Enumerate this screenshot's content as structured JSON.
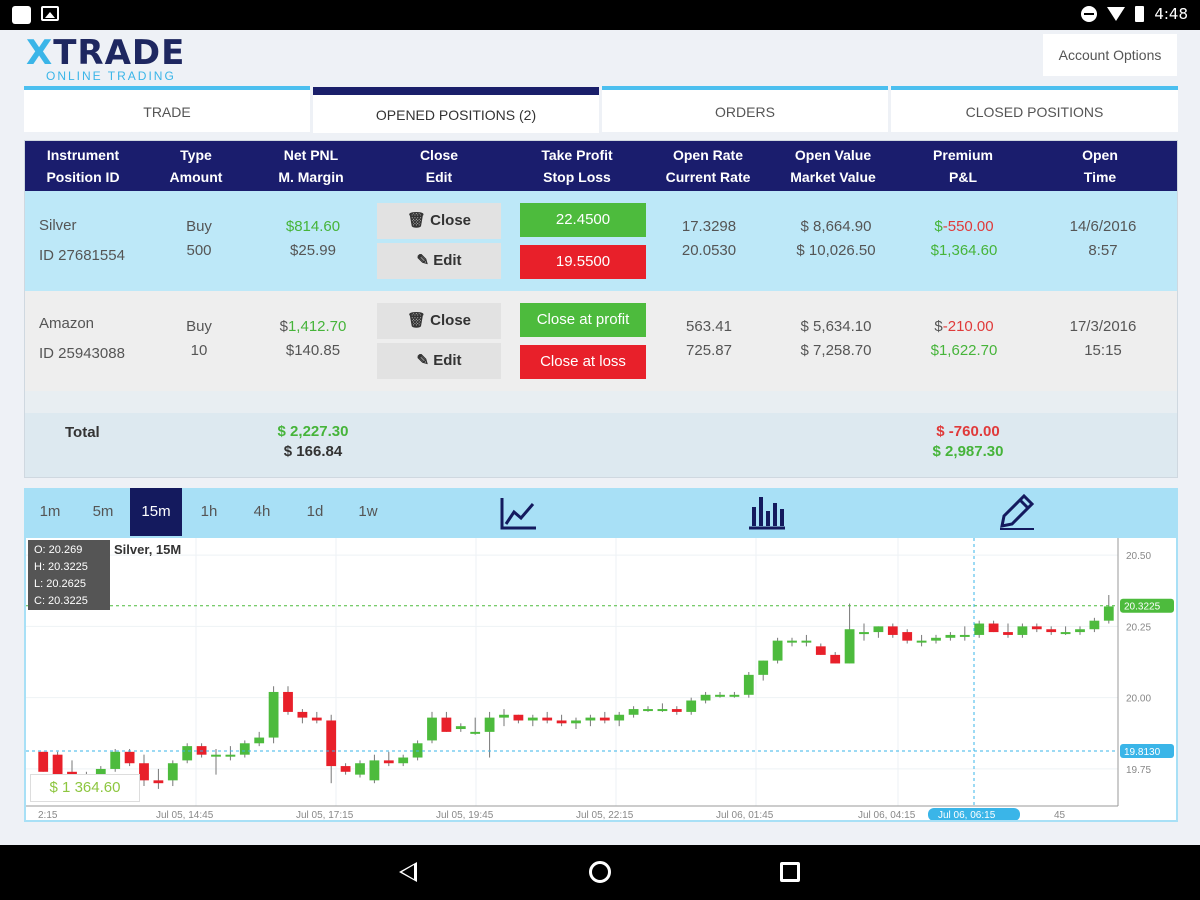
{
  "status_bar": {
    "time": "4:48"
  },
  "brand": {
    "logo_x": "X",
    "logo_rest": "TRADE",
    "tagline": "ONLINE TRADING"
  },
  "header": {
    "account_options": "Account Options"
  },
  "tabs": [
    {
      "label": "TRADE"
    },
    {
      "label": "OPENED POSITIONS (2)",
      "active": true
    },
    {
      "label": "ORDERS"
    },
    {
      "label": "CLOSED POSITIONS"
    }
  ],
  "table": {
    "columns": [
      {
        "line1": "Instrument",
        "line2": "Position ID"
      },
      {
        "line1": "Type",
        "line2": "Amount"
      },
      {
        "line1": "Net PNL",
        "line2": "M. Margin"
      },
      {
        "line1": "Close",
        "line2": "Edit"
      },
      {
        "line1": "Take Profit",
        "line2": "Stop Loss"
      },
      {
        "line1": "Open Rate",
        "line2": "Current Rate"
      },
      {
        "line1": "Open Value",
        "line2": "Market Value"
      },
      {
        "line1": "Premium",
        "line2": "P&L"
      },
      {
        "line1": "Open",
        "line2": "Time"
      }
    ],
    "rows": [
      {
        "instrument": "Silver",
        "position_id": "ID 27681554",
        "type": "Buy",
        "amount": "500",
        "pnl_symbol": "$",
        "pnl_value": "814.60",
        "margin": "$25.99",
        "close_label": "Close",
        "edit_label": "Edit",
        "take_profit": "22.4500",
        "stop_loss": "19.5500",
        "open_rate": "17.3298",
        "current_rate": "20.0530",
        "open_value": "$ 8,664.90",
        "market_value": "$ 10,026.50",
        "premium_symbol": "$",
        "premium_value": "-550.00",
        "pl": "$1,364.60",
        "open_date": "14/6/2016",
        "open_time": "8:57"
      },
      {
        "instrument": "Amazon",
        "position_id": "ID 25943088",
        "type": "Buy",
        "amount": "10",
        "pnl_symbol": "$",
        "pnl_value": "1,412.70",
        "margin": "$140.85",
        "close_label": "Close",
        "edit_label": "Edit",
        "take_profit": "Close at profit",
        "stop_loss": "Close at loss",
        "open_rate": "563.41",
        "current_rate": "725.87",
        "open_value": "$ 5,634.10",
        "market_value": "$ 7,258.70",
        "premium_symbol": "$",
        "premium_value": "-210.00",
        "pl": "$1,622.70",
        "open_date": "17/3/2016",
        "open_time": "15:15"
      }
    ],
    "total": {
      "label": "Total",
      "net_pnl": "$ 2,227.30",
      "margin": "$ 166.84",
      "premium": "$ -760.00",
      "pl": "$ 2,987.30"
    }
  },
  "chart_toolbar": {
    "timeframes": [
      "1m",
      "5m",
      "15m",
      "1h",
      "4h",
      "1d",
      "1w"
    ],
    "active": "15m",
    "tools": [
      "line-chart-icon",
      "bar-chart-icon",
      "draw-pen-icon"
    ]
  },
  "colors": {
    "accent": "#4bbfef",
    "brand": "#1a1d6d",
    "up": "#4dbb3d",
    "down": "#e8202a"
  },
  "chart_data": {
    "type": "candlestick",
    "title": "Silver, 15M",
    "ohlc_readout": {
      "o": "O: 20.269",
      "h": "H: 20.3225",
      "l": "L: 20.2625",
      "c": "C: 20.3225"
    },
    "ylim": [
      19.62,
      20.56
    ],
    "y_ticks": [
      "20.50",
      "20.25",
      "20.00",
      "19.75"
    ],
    "x_ticks": [
      "2:15",
      "Jul 05, 14:45",
      "Jul 05, 17:15",
      "Jul 05, 19:45",
      "Jul 05, 22:15",
      "Jul 06, 01:45",
      "Jul 06, 04:15",
      "45"
    ],
    "crosshair_time": "Jul 06, 06:15",
    "current_price_label": "20.3225",
    "stop_line_label": "19.8130",
    "pl_badge": "$ 1 364.60",
    "candles": [
      [
        19.81,
        19.81,
        19.74,
        19.74
      ],
      [
        19.8,
        19.81,
        19.73,
        19.73
      ],
      [
        19.74,
        19.78,
        19.7,
        19.71
      ],
      [
        19.71,
        19.74,
        19.69,
        19.72
      ],
      [
        19.72,
        19.76,
        19.69,
        19.75
      ],
      [
        19.75,
        19.82,
        19.74,
        19.81
      ],
      [
        19.81,
        19.82,
        19.76,
        19.77
      ],
      [
        19.77,
        19.8,
        19.69,
        19.71
      ],
      [
        19.71,
        19.75,
        19.68,
        19.7
      ],
      [
        19.71,
        19.78,
        19.69,
        19.77
      ],
      [
        19.78,
        19.84,
        19.77,
        19.83
      ],
      [
        19.83,
        19.84,
        19.79,
        19.8
      ],
      [
        19.8,
        19.82,
        19.73,
        19.8
      ],
      [
        19.8,
        19.83,
        19.78,
        19.8
      ],
      [
        19.8,
        19.85,
        19.79,
        19.84
      ],
      [
        19.84,
        19.88,
        19.83,
        19.86
      ],
      [
        19.86,
        20.04,
        19.84,
        20.02
      ],
      [
        20.02,
        20.04,
        19.94,
        19.95
      ],
      [
        19.95,
        19.96,
        19.91,
        19.93
      ],
      [
        19.93,
        19.95,
        19.91,
        19.92
      ],
      [
        19.92,
        19.94,
        19.7,
        19.76
      ],
      [
        19.76,
        19.77,
        19.73,
        19.74
      ],
      [
        19.73,
        19.78,
        19.72,
        19.77
      ],
      [
        19.71,
        19.8,
        19.7,
        19.78
      ],
      [
        19.78,
        19.81,
        19.76,
        19.77
      ],
      [
        19.77,
        19.8,
        19.76,
        19.79
      ],
      [
        19.79,
        19.85,
        19.78,
        19.84
      ],
      [
        19.85,
        19.95,
        19.84,
        19.93
      ],
      [
        19.93,
        19.95,
        19.88,
        19.88
      ],
      [
        19.89,
        19.91,
        19.88,
        19.9
      ],
      [
        19.88,
        19.93,
        19.87,
        19.88
      ],
      [
        19.88,
        19.95,
        19.79,
        19.93
      ],
      [
        19.93,
        19.96,
        19.9,
        19.94
      ],
      [
        19.94,
        19.94,
        19.91,
        19.92
      ],
      [
        19.92,
        19.94,
        19.9,
        19.93
      ],
      [
        19.93,
        19.95,
        19.91,
        19.92
      ],
      [
        19.92,
        19.94,
        19.9,
        19.91
      ],
      [
        19.91,
        19.93,
        19.89,
        19.92
      ],
      [
        19.92,
        19.94,
        19.9,
        19.93
      ],
      [
        19.93,
        19.95,
        19.91,
        19.92
      ],
      [
        19.92,
        19.95,
        19.9,
        19.94
      ],
      [
        19.94,
        19.97,
        19.93,
        19.96
      ],
      [
        19.96,
        19.97,
        19.95,
        19.96
      ],
      [
        19.96,
        19.98,
        19.95,
        19.96
      ],
      [
        19.96,
        19.97,
        19.94,
        19.95
      ],
      [
        19.95,
        20.0,
        19.94,
        19.99
      ],
      [
        19.99,
        20.02,
        19.98,
        20.01
      ],
      [
        20.01,
        20.02,
        20.0,
        20.01
      ],
      [
        20.01,
        20.02,
        20.0,
        20.01
      ],
      [
        20.01,
        20.09,
        20.0,
        20.08
      ],
      [
        20.08,
        20.13,
        20.06,
        20.13
      ],
      [
        20.13,
        20.21,
        20.12,
        20.2
      ],
      [
        20.2,
        20.21,
        20.18,
        20.2
      ],
      [
        20.2,
        20.22,
        20.18,
        20.2
      ],
      [
        20.18,
        20.19,
        20.15,
        20.15
      ],
      [
        20.15,
        20.16,
        20.12,
        20.12
      ],
      [
        20.12,
        20.33,
        20.12,
        20.24
      ],
      [
        20.23,
        20.26,
        20.2,
        20.23
      ],
      [
        20.23,
        20.25,
        20.21,
        20.25
      ],
      [
        20.25,
        20.26,
        20.21,
        20.22
      ],
      [
        20.23,
        20.24,
        20.19,
        20.2
      ],
      [
        20.2,
        20.22,
        20.18,
        20.2
      ],
      [
        20.2,
        20.22,
        20.19,
        20.21
      ],
      [
        20.21,
        20.23,
        20.2,
        20.22
      ],
      [
        20.22,
        20.25,
        20.2,
        20.22
      ],
      [
        20.22,
        20.27,
        20.21,
        20.26
      ],
      [
        20.26,
        20.27,
        20.23,
        20.23
      ],
      [
        20.23,
        20.26,
        20.21,
        20.22
      ],
      [
        20.22,
        20.26,
        20.21,
        20.25
      ],
      [
        20.25,
        20.26,
        20.23,
        20.24
      ],
      [
        20.24,
        20.25,
        20.22,
        20.23
      ],
      [
        20.23,
        20.25,
        20.22,
        20.23
      ],
      [
        20.23,
        20.25,
        20.22,
        20.24
      ],
      [
        20.24,
        20.28,
        20.23,
        20.27
      ],
      [
        20.27,
        20.36,
        20.26,
        20.32
      ]
    ]
  }
}
